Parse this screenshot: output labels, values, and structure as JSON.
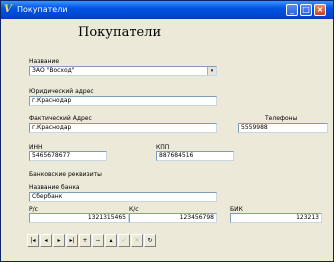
{
  "window": {
    "title": "Покупатели",
    "minimize_glyph": "_",
    "maximize_glyph": "□",
    "close_glyph": "×",
    "app_icon_glyph": "V"
  },
  "form": {
    "heading": "Покупатели",
    "name": {
      "label": "Название",
      "value": "ЗАО \"Восход\"",
      "dropdown_glyph": "▾"
    },
    "legal_address": {
      "label": "Юридический адрес",
      "value": "г.Краснодар"
    },
    "actual_address": {
      "label": "Фактический Адрес",
      "value": "г.Краснодар"
    },
    "phone": {
      "label": "Телефоны",
      "value": "5559988"
    },
    "inn": {
      "label": "ИНН",
      "value": "5465678677"
    },
    "kpp": {
      "label": "КПП",
      "value": "887684516"
    },
    "bank_details_label": "Банковские реквизиты",
    "bank_name": {
      "label": "Название банка",
      "value": "Сбербанк"
    },
    "account": {
      "label": "Р/с",
      "value": "1321315465"
    },
    "corr_account": {
      "label": "К/с",
      "value": "123456798"
    },
    "bik": {
      "label": "БИК",
      "value": "123213"
    }
  },
  "navigator": {
    "buttons": [
      {
        "name": "first-record-button",
        "glyph": "|◂",
        "enabled": true
      },
      {
        "name": "prior-record-button",
        "glyph": "◂",
        "enabled": true
      },
      {
        "name": "next-record-button",
        "glyph": "▸",
        "enabled": true
      },
      {
        "name": "last-record-button",
        "glyph": "▸|",
        "enabled": true
      },
      {
        "name": "insert-record-button",
        "glyph": "+",
        "enabled": true
      },
      {
        "name": "delete-record-button",
        "glyph": "−",
        "enabled": true
      },
      {
        "name": "edit-record-button",
        "glyph": "▴",
        "enabled": true
      },
      {
        "name": "post-record-button",
        "glyph": "✓",
        "enabled": false
      },
      {
        "name": "cancel-record-button",
        "glyph": "✕",
        "enabled": false
      },
      {
        "name": "refresh-button",
        "glyph": "↻",
        "enabled": true
      }
    ]
  }
}
